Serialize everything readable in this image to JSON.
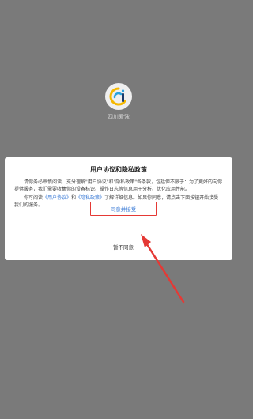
{
  "app": {
    "icon": "app-logo-icon",
    "name": "四川爱泳",
    "brand_colors": [
      "#f5b800",
      "#2aa3de",
      "#1a3a6b"
    ]
  },
  "dialog": {
    "title": "用户协议和隐私政策",
    "para1": "请你务必审慎阅读、充分理解\"用户协议\"和\"隐私政策\"各条款，包括但不限于：为了更好的向你提供服务，我们需要收集你的设备标识、操作日志等信息用于分析、优化应用性能。",
    "para2_prefix": "你可阅读",
    "link_user_agreement": "《用户协议》",
    "para2_and": "和",
    "link_privacy_policy": "《隐私政策》",
    "para2_suffix": "了解详细信息。如果你同意，请点击下面按钮开始接受我们的服务。",
    "agree_label": "同意并接受",
    "disagree_label": "暂不同意"
  },
  "annotation": {
    "highlight_color": "#e53935",
    "arrow_icon": "red-arrow-icon"
  }
}
